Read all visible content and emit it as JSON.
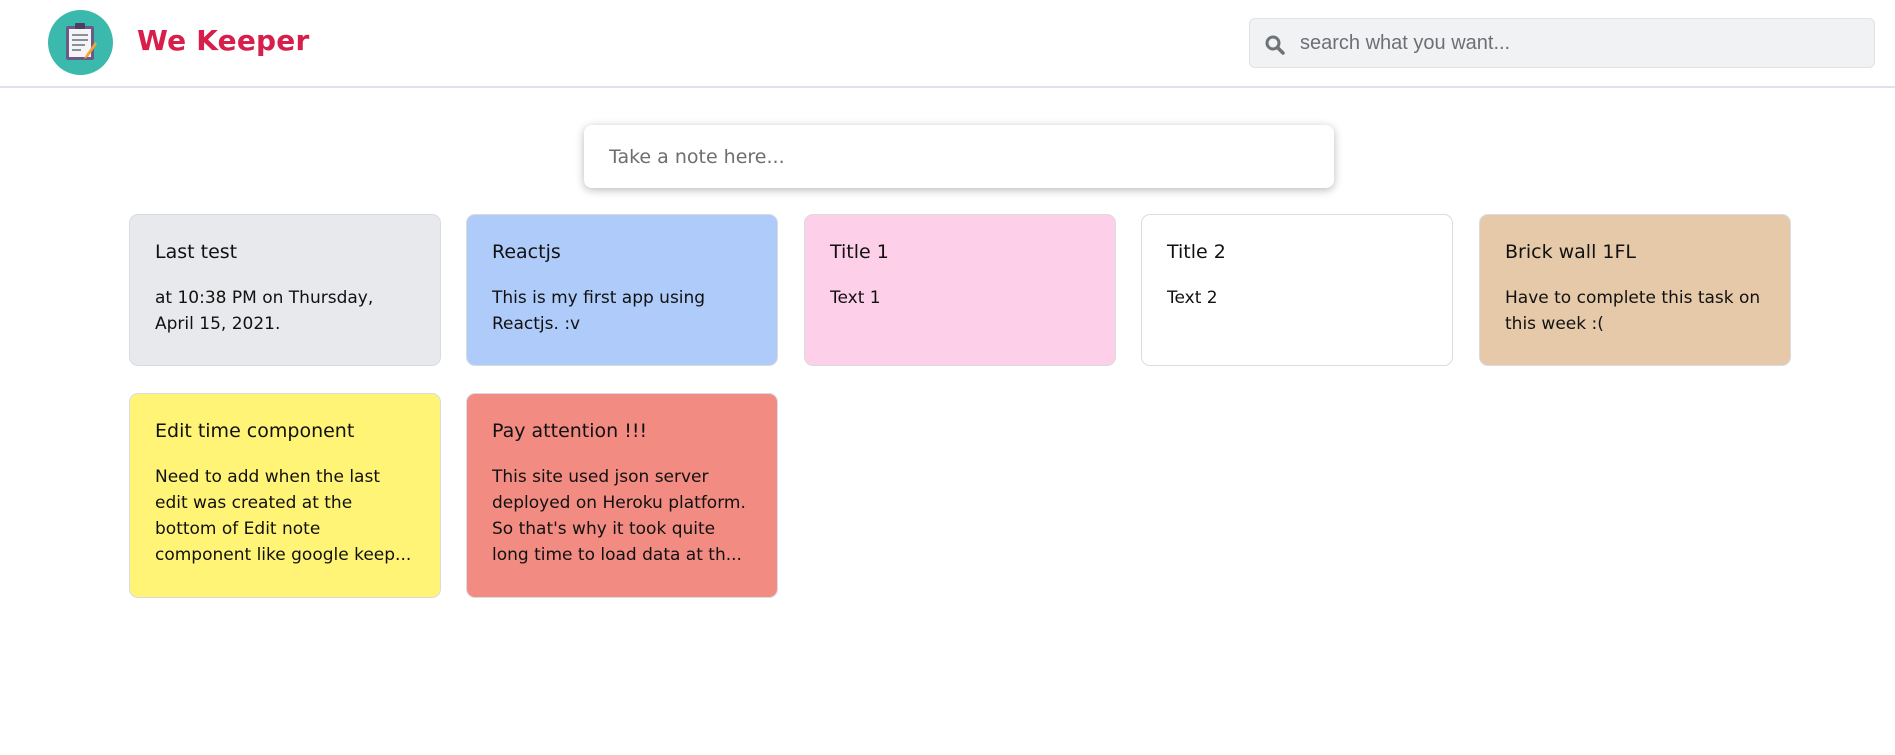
{
  "header": {
    "brand": "We Keeper",
    "logo_icon": "clipboard-note-icon",
    "logo_color": "#3bb9ad",
    "brand_color": "#d81e4a"
  },
  "search": {
    "placeholder": "search what you want...",
    "value": "",
    "icon": "search-icon"
  },
  "composer": {
    "placeholder": "Take a note here..."
  },
  "notes": [
    {
      "title": "Last test",
      "text": "at 10:38 PM on Thursday, April 15, 2021.",
      "color": "#e8e9ec"
    },
    {
      "title": "Reactjs",
      "text": "This is my first app using Reactjs. :v",
      "color": "#aecbfa"
    },
    {
      "title": "Title 1",
      "text": "Text 1",
      "color": "#fdcfe8"
    },
    {
      "title": "Title 2",
      "text": "Text 2",
      "color": "#ffffff"
    },
    {
      "title": "Brick wall 1FL",
      "text": "Have to complete this task on this week :(",
      "color": "#e6c9a8"
    },
    {
      "title": "Edit time component",
      "text": "Need to add when the last edit was created at the bottom of Edit note component like google keep...",
      "color": "#fff475"
    },
    {
      "title": "Pay attention !!!",
      "text": "This site used json server deployed on Heroku platform. So that's why it took quite long time to load data at th...",
      "color": "#f28b82"
    }
  ]
}
